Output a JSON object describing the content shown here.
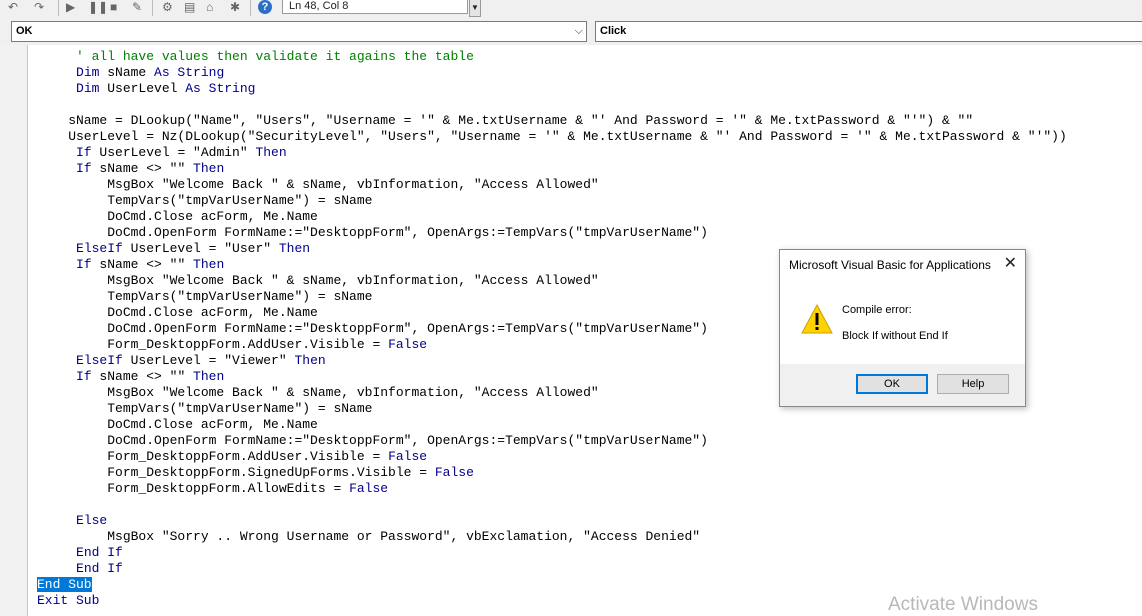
{
  "toolbar": {
    "icons": [
      {
        "name": "undo-icon",
        "glyph": "↶"
      },
      {
        "name": "redo-icon",
        "glyph": "↷"
      },
      {
        "name": "run-icon",
        "glyph": "▶"
      },
      {
        "name": "break-icon",
        "glyph": "❚❚"
      },
      {
        "name": "reset-icon",
        "glyph": "■"
      },
      {
        "name": "design-mode-icon",
        "glyph": "✎"
      },
      {
        "name": "project-explorer-icon",
        "glyph": "⚙"
      },
      {
        "name": "properties-icon",
        "glyph": "▤"
      },
      {
        "name": "object-browser-icon",
        "glyph": "⌂"
      },
      {
        "name": "toolbox-icon",
        "glyph": "✱"
      },
      {
        "name": "help-icon",
        "glyph": "?"
      }
    ],
    "status": "Ln 48, Col 8"
  },
  "combos": {
    "object": "OK",
    "procedure": "Click"
  },
  "code_lines": [
    [
      {
        "t": "     "
      },
      {
        "t": "' all have values then validate it agains the table",
        "c": "cm"
      }
    ],
    [
      {
        "t": "     "
      },
      {
        "t": "Dim",
        "c": "kw"
      },
      {
        "t": " sName "
      },
      {
        "t": "As String",
        "c": "kw"
      }
    ],
    [
      {
        "t": "     "
      },
      {
        "t": "Dim",
        "c": "kw"
      },
      {
        "t": " UserLevel "
      },
      {
        "t": "As String",
        "c": "kw"
      }
    ],
    [
      {
        "t": ""
      }
    ],
    [
      {
        "t": "    sName = DLookup(\"Name\", \"Users\", \"Username = '\" & Me.txtUsername & \"' And Password = '\" & Me.txtPassword & \"'\") & \"\""
      }
    ],
    [
      {
        "t": "    UserLevel = Nz(DLookup(\"SecurityLevel\", \"Users\", \"Username = '\" & Me.txtUsername & \"' And Password = '\" & Me.txtPassword & \"'\"))"
      }
    ],
    [
      {
        "t": "     "
      },
      {
        "t": "If",
        "c": "kw"
      },
      {
        "t": " UserLevel = \"Admin\" "
      },
      {
        "t": "Then",
        "c": "kw"
      }
    ],
    [
      {
        "t": "     "
      },
      {
        "t": "If",
        "c": "kw"
      },
      {
        "t": " sName <> \"\" "
      },
      {
        "t": "Then",
        "c": "kw"
      }
    ],
    [
      {
        "t": "         MsgBox \"Welcome Back \" & sName, vbInformation, \"Access Allowed\""
      }
    ],
    [
      {
        "t": "         TempVars(\"tmpVarUserName\") = sName"
      }
    ],
    [
      {
        "t": "         DoCmd.Close acForm, Me.Name"
      }
    ],
    [
      {
        "t": "         DoCmd.OpenForm FormName:=\"DesktoppForm\", OpenArgs:=TempVars(\"tmpVarUserName\")"
      }
    ],
    [
      {
        "t": "     "
      },
      {
        "t": "ElseIf",
        "c": "kw"
      },
      {
        "t": " UserLevel = \"User\" "
      },
      {
        "t": "Then",
        "c": "kw"
      }
    ],
    [
      {
        "t": "     "
      },
      {
        "t": "If",
        "c": "kw"
      },
      {
        "t": " sName <> \"\" "
      },
      {
        "t": "Then",
        "c": "kw"
      }
    ],
    [
      {
        "t": "         MsgBox \"Welcome Back \" & sName, vbInformation, \"Access Allowed\""
      }
    ],
    [
      {
        "t": "         TempVars(\"tmpVarUserName\") = sName"
      }
    ],
    [
      {
        "t": "         DoCmd.Close acForm, Me.Name"
      }
    ],
    [
      {
        "t": "         DoCmd.OpenForm FormName:=\"DesktoppForm\", OpenArgs:=TempVars(\"tmpVarUserName\")"
      }
    ],
    [
      {
        "t": "         Form_DesktoppForm.AddUser.Visible = "
      },
      {
        "t": "False",
        "c": "kw"
      }
    ],
    [
      {
        "t": "     "
      },
      {
        "t": "ElseIf",
        "c": "kw"
      },
      {
        "t": " UserLevel = \"Viewer\" "
      },
      {
        "t": "Then",
        "c": "kw"
      }
    ],
    [
      {
        "t": "     "
      },
      {
        "t": "If",
        "c": "kw"
      },
      {
        "t": " sName <> \"\" "
      },
      {
        "t": "Then",
        "c": "kw"
      }
    ],
    [
      {
        "t": "         MsgBox \"Welcome Back \" & sName, vbInformation, \"Access Allowed\""
      }
    ],
    [
      {
        "t": "         TempVars(\"tmpVarUserName\") = sName"
      }
    ],
    [
      {
        "t": "         DoCmd.Close acForm, Me.Name"
      }
    ],
    [
      {
        "t": "         DoCmd.OpenForm FormName:=\"DesktoppForm\", OpenArgs:=TempVars(\"tmpVarUserName\")"
      }
    ],
    [
      {
        "t": "         Form_DesktoppForm.AddUser.Visible = "
      },
      {
        "t": "False",
        "c": "kw"
      }
    ],
    [
      {
        "t": "         Form_DesktoppForm.SignedUpForms.Visible = "
      },
      {
        "t": "False",
        "c": "kw"
      }
    ],
    [
      {
        "t": "         Form_DesktoppForm.AllowEdits = "
      },
      {
        "t": "False",
        "c": "kw"
      }
    ],
    [
      {
        "t": ""
      }
    ],
    [
      {
        "t": "     "
      },
      {
        "t": "Else",
        "c": "kw"
      }
    ],
    [
      {
        "t": "         MsgBox \"Sorry .. Wrong Username or Password\", vbExclamation, \"Access Denied\""
      }
    ],
    [
      {
        "t": "     "
      },
      {
        "t": "End If",
        "c": "kw"
      }
    ],
    [
      {
        "t": "     "
      },
      {
        "t": "End If",
        "c": "kw"
      }
    ],
    [
      {
        "t": "End Sub",
        "c": "kw sel"
      }
    ],
    [
      {
        "t": "Exit Sub",
        "c": "kw"
      }
    ]
  ],
  "dialog": {
    "title": "Microsoft Visual Basic for Applications",
    "close_glyph": "✕",
    "message_title": "Compile error:",
    "message_body": "Block If without End If",
    "ok_label": "OK",
    "help_label": "Help"
  },
  "watermark": "Activate Windows"
}
